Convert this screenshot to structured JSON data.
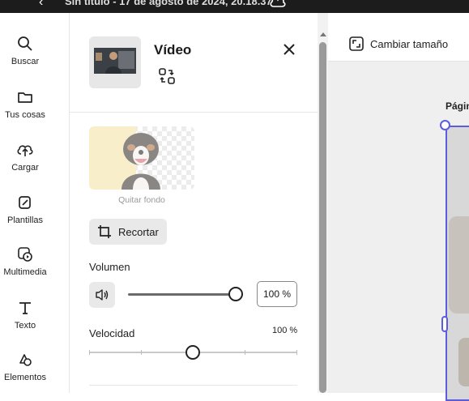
{
  "topbar": {
    "document_title": "Sin título - 17 de agosto de 2024, 20.18.37",
    "logo_icon": "adobe-express-logo",
    "back_icon": "chevron-left-icon",
    "cloud_icon": "cloud-icon"
  },
  "rail": {
    "items": [
      {
        "label": "Buscar",
        "icon": "search-icon"
      },
      {
        "label": "Tus cosas",
        "icon": "folder-icon"
      },
      {
        "label": "Cargar",
        "icon": "cloud-upload-icon"
      },
      {
        "label": "Plantillas",
        "icon": "templates-icon"
      },
      {
        "label": "Multimedia",
        "icon": "media-icon"
      },
      {
        "label": "Texto",
        "icon": "text-icon"
      },
      {
        "label": "Elementos",
        "icon": "shapes-icon"
      }
    ]
  },
  "panel": {
    "title": "Vídeo",
    "remove_background_label": "Quitar fondo",
    "crop_label": "Recortar",
    "volume": {
      "label": "Volumen",
      "value_text": "100 %",
      "value": 100,
      "max": 100
    },
    "speed": {
      "label": "Velocidad",
      "value_text": "100 %",
      "value": 100
    }
  },
  "canvas": {
    "resize_label": "Cambiar tamaño",
    "page_label": "Págin"
  },
  "colors": {
    "topbar": "#1c1c1c",
    "selection": "#5c5ce0",
    "button_bg": "#e9e9e9"
  }
}
